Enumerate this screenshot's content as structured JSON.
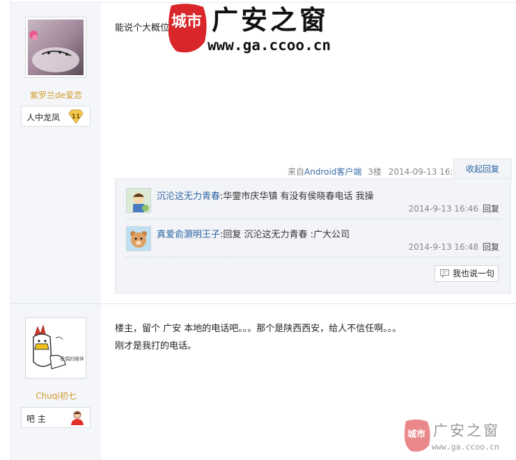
{
  "watermark": {
    "seal_text": "城市",
    "site_name": "广安之窗",
    "url": "www.ga.ccoo.cn"
  },
  "posts": [
    {
      "username": "紫罗兰de爱恋",
      "rank_title": "人中龙凤",
      "level": "11",
      "content_lines": [
        "能说个大概位"
      ],
      "source_prefix": "来自",
      "source_link": "Android客户端",
      "floor": "3楼",
      "datetime": "2014-09-13 16:44",
      "collapse_label": "收起回复",
      "replies": [
        {
          "user": "沉沦这无力青春",
          "text": ":华蓥市庆华镇 有没有侯晓春电话 我操",
          "time": "2014-9-13 16:46",
          "reply_label": "回复"
        },
        {
          "user": "真爱俞灏明王子",
          "text": ":回复 沉沦这无力青春 :广大公司",
          "time": "2014-9-13 16:48",
          "reply_label": "回复"
        }
      ],
      "say_label": "我也说一句"
    },
    {
      "username": "Chuqi初七",
      "rank_title": "吧 主",
      "avatar_caption": "看偶的眼神",
      "content_lines": [
        "楼主，留个 广安 本地的电话吧。。。那个是陕西西安，给人不信任啊。。。",
        "刚才是我打的电话。"
      ]
    }
  ],
  "colors": {
    "username": "#d19a2a",
    "link": "#2d64a3",
    "sidebar_bg": "#f4f6f9",
    "reply_bg": "#f2f4f7",
    "watermark_red": "#d8262b"
  }
}
